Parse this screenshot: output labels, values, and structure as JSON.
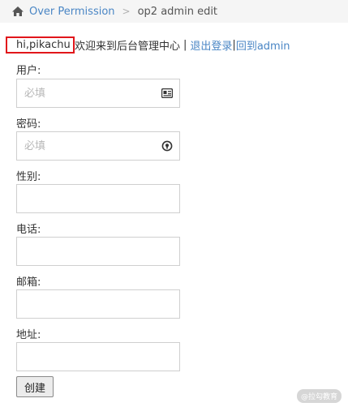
{
  "breadcrumb": {
    "parent": "Over Permission",
    "separator": ">",
    "current": "op2 admin edit"
  },
  "welcome": {
    "user": "hi,pikachu",
    "message": "欢迎来到后台管理中心",
    "pipe1": "|",
    "logout": "退出登录",
    "pipe2": "|",
    "back_admin": "回到admin"
  },
  "form": {
    "username_label": "用户:",
    "username_placeholder": "必填",
    "password_label": "密码:",
    "password_placeholder": "必填",
    "gender_label": "性别:",
    "phone_label": "电话:",
    "email_label": "邮箱:",
    "address_label": "地址:",
    "submit_label": "创建"
  },
  "watermark": "@拉勾教育",
  "colors": {
    "link": "#4a86c5",
    "highlight_box": "#e1161b",
    "breadcrumb_bg": "#f5f5f5"
  },
  "icons": {
    "home": "home-icon",
    "username_field": "id-card-icon",
    "password_field": "lock-icon"
  }
}
